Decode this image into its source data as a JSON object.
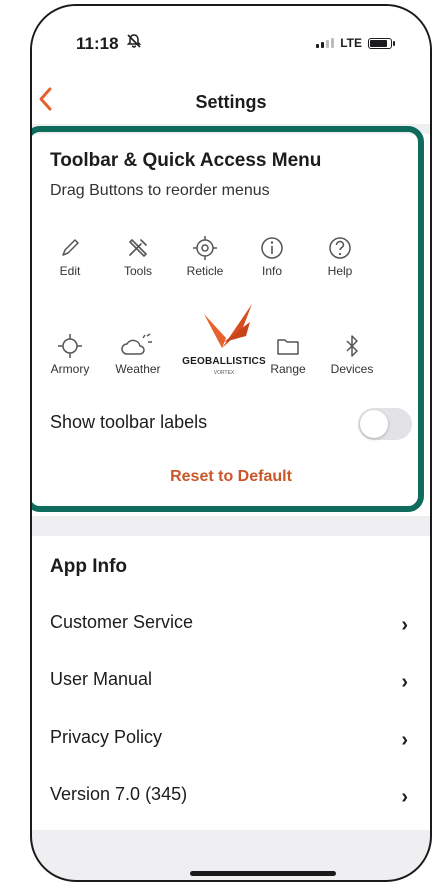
{
  "status_bar": {
    "time": "11:18",
    "mute_icon": "bell-slash-icon",
    "network": "LTE"
  },
  "nav": {
    "title": "Settings",
    "back_icon": "chevron-left-icon",
    "accent": "#e8602c"
  },
  "toolbar_card": {
    "title": "Toolbar & Quick Access Menu",
    "subtitle": "Drag Buttons to reorder menus",
    "row1": [
      {
        "label": "Edit",
        "icon": "pencil-icon"
      },
      {
        "label": "Tools",
        "icon": "tools-icon"
      },
      {
        "label": "Reticle",
        "icon": "reticle-icon"
      },
      {
        "label": "Info",
        "icon": "info-icon"
      },
      {
        "label": "Help",
        "icon": "help-icon"
      }
    ],
    "row2": [
      {
        "label": "Armory",
        "icon": "crosshair-icon"
      },
      {
        "label": "Weather",
        "icon": "weather-icon"
      },
      {
        "label": "Range",
        "icon": "folder-icon"
      },
      {
        "label": "Devices",
        "icon": "bluetooth-icon"
      }
    ],
    "logo": {
      "brand": "GEOBALLISTICS",
      "sub": "VORTEX"
    },
    "toggle_label": "Show toolbar labels",
    "toggle_on": false,
    "reset_label": "Reset to Default",
    "highlight_color": "#0f6b5c"
  },
  "app_info": {
    "title": "App Info",
    "rows": [
      {
        "label": "Customer Service"
      },
      {
        "label": "User Manual"
      },
      {
        "label": "Privacy Policy"
      },
      {
        "label": "Version 7.0 (345)"
      }
    ]
  }
}
